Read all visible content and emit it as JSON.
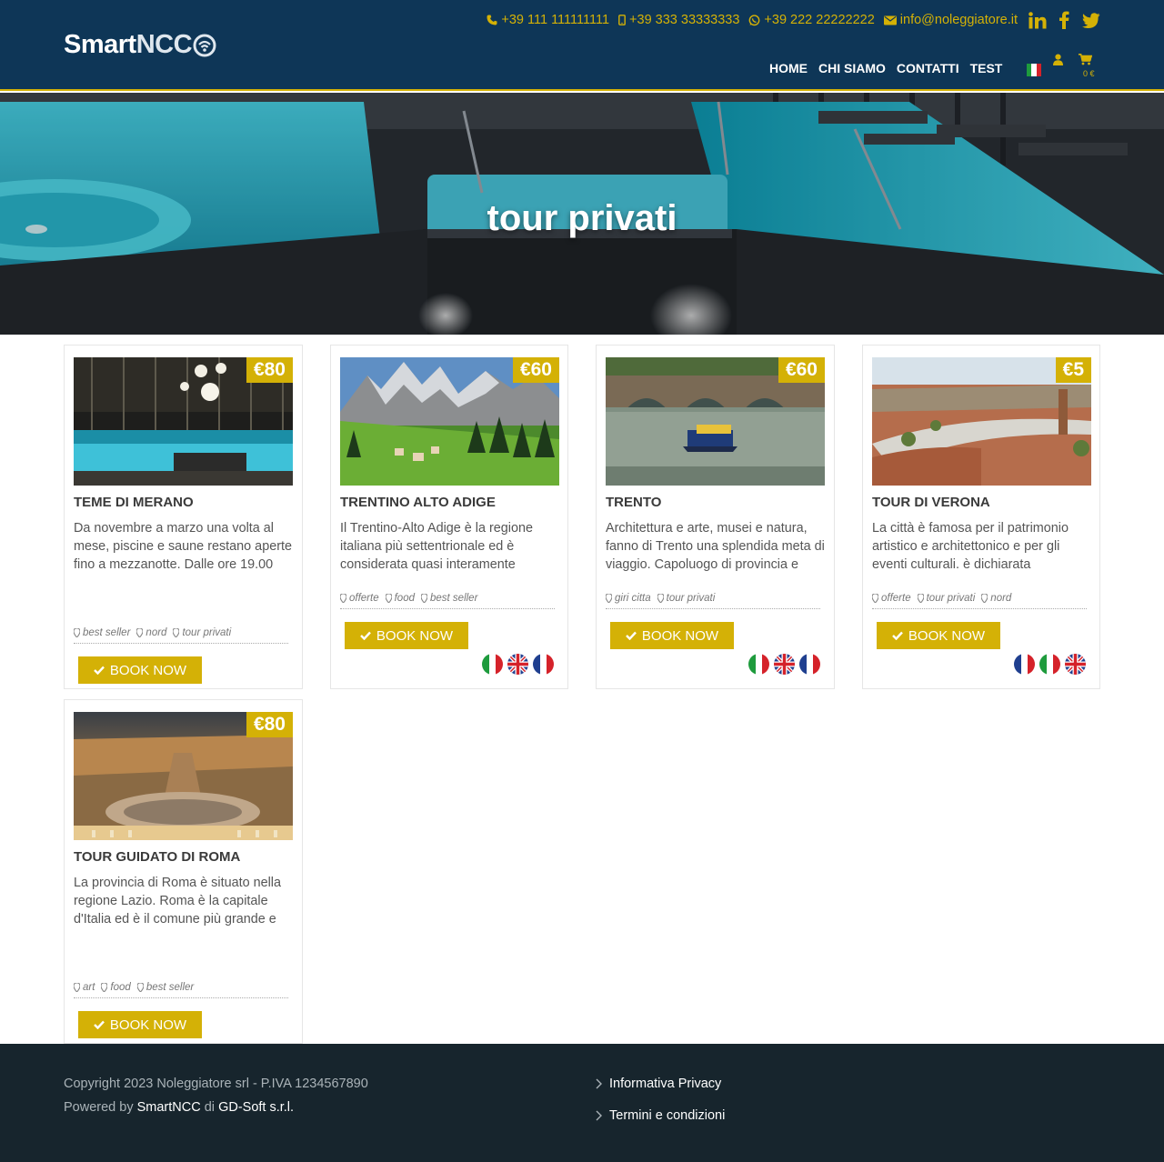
{
  "header": {
    "logo_text_a": "Smart",
    "logo_text_b": "NCC",
    "phone": "+39 111 111111111",
    "mobile": "+39 333 33333333",
    "whatsapp": "+39 222 22222222",
    "email": "info@noleggiatore.it",
    "nav": [
      "HOME",
      "CHI SIAMO",
      "CONTATTI",
      "TEST"
    ],
    "cart_total": "0 €",
    "accent_color": "#d4b106",
    "bg_color": "#0e3657"
  },
  "hero": {
    "title": "tour privati"
  },
  "cards": [
    {
      "price": "€80",
      "title": "TEME DI MERANO",
      "desc": "Da novembre a marzo una volta al mese, piscine e saune restano aperte fino a mezzanotte. Dalle ore 19.00",
      "tags": [
        "best seller",
        "nord",
        "tour privati"
      ],
      "book": "BOOK NOW",
      "flags": []
    },
    {
      "price": "€60",
      "title": "TRENTINO ALTO ADIGE",
      "desc": "Il Trentino-Alto Adige è la regione italiana più settentrionale ed è considerata quasi interamente",
      "tags": [
        "offerte",
        "food",
        "best seller"
      ],
      "book": "BOOK NOW",
      "flags": [
        "it",
        "uk",
        "fr"
      ]
    },
    {
      "price": "€60",
      "title": "TRENTO",
      "desc": "Architettura e arte, musei e natura, fanno di Trento una splendida meta di viaggio. Capoluogo di provincia e della",
      "tags": [
        "giri citta",
        "tour privati"
      ],
      "book": "BOOK NOW",
      "flags": [
        "it",
        "uk",
        "fr"
      ]
    },
    {
      "price": "€5",
      "title": "TOUR DI VERONA",
      "desc": "La città è famosa per il patrimonio artistico e architettonico e per gli eventi culturali. è dichiarata",
      "tags": [
        "offerte",
        "tour privati",
        "nord"
      ],
      "book": "BOOK NOW",
      "flags": [
        "fr",
        "it",
        "uk"
      ]
    },
    {
      "price": "€80",
      "title": "TOUR GUIDATO DI ROMA",
      "desc": "La provincia di Roma è situato nella regione Lazio. Roma è la capitale d'Italia ed è il comune più grande e più",
      "tags": [
        "art",
        "food",
        "best seller"
      ],
      "book": "BOOK NOW",
      "flags": []
    }
  ],
  "footer": {
    "copyright": "Copyright 2023 Noleggiatore srl - P.IVA 1234567890",
    "powered_prefix": "Powered by",
    "powered_brand": "SmartNCC",
    "powered_by_word": "di",
    "powered_company": "GD-Soft s.r.l.",
    "links": [
      "Informativa Privacy",
      "Termini e condizioni"
    ]
  }
}
